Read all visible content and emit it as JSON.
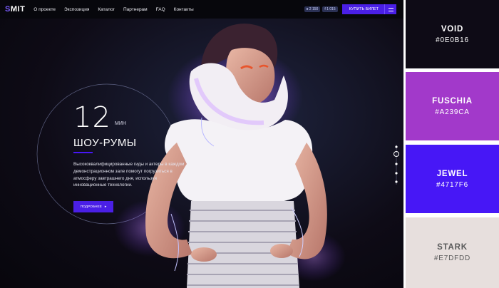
{
  "nav": {
    "logo_first": "S",
    "logo_rest": "MIT",
    "items": [
      "О проекте",
      "Экспозиция",
      "Каталог",
      "Партнерам",
      "FAQ",
      "Контакты"
    ],
    "social": [
      {
        "icon": "vk-icon",
        "count": "2 150"
      },
      {
        "icon": "facebook-icon",
        "count": "1 015"
      }
    ],
    "buy_label": "КУПИТЬ БИЛЕТ"
  },
  "hero": {
    "number": "12",
    "unit": "МИН",
    "subtitle": "ШОУ-РУМЫ",
    "description": "Высококвалифицированные гиды и актеры в каждом демонстрационном зале помогут погрузиться в атмосферу завтрашнего дня, используя инновационные технологии.",
    "more_label": "ПОДРОБНЕЕ",
    "more_arrow": "▸"
  },
  "palette": [
    {
      "name": "VOID",
      "hex": "#0E0B16",
      "color": "#0e0b16",
      "text_color": "#ffffff"
    },
    {
      "name": "FUSCHIA",
      "hex": "#A239CA",
      "color": "#a239ca",
      "text_color": "#ffffff"
    },
    {
      "name": "JEWEL",
      "hex": "#4717F6",
      "color": "#4717f6",
      "text_color": "#ffffff"
    },
    {
      "name": "STARK",
      "hex": "#E7DFDD",
      "color": "#e7dfdd",
      "text_color": "#5a5a5a"
    }
  ]
}
